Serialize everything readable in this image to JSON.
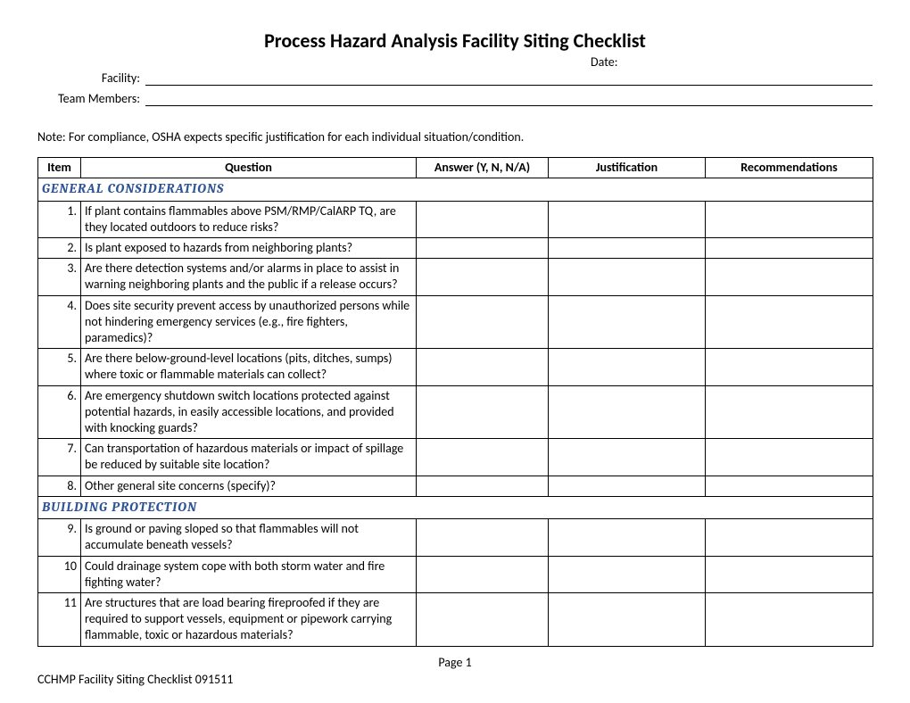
{
  "title": "Process Hazard Analysis Facility Siting Checklist",
  "header": {
    "facility_label": "Facility:",
    "team_label": "Team Members:",
    "date_label": "Date:"
  },
  "note": "Note:  For compliance, OSHA expects specific justification for each individual situation/condition.",
  "columns": {
    "item": "Item",
    "question": "Question",
    "answer": "Answer (Y, N, N/A)",
    "justification": "Justification",
    "recommendations": "Recommendations"
  },
  "sections": [
    {
      "title": "GENERAL CONSIDERATIONS",
      "rows": [
        {
          "num": "1.",
          "q": "If plant contains flammables above PSM/RMP/CalARP TQ, are they located outdoors to reduce risks?"
        },
        {
          "num": "2.",
          "q": "Is plant exposed to hazards from neighboring plants?"
        },
        {
          "num": "3.",
          "q": "Are there detection systems and/or alarms in place to assist in warning neighboring plants and the public if a release occurs?"
        },
        {
          "num": "4.",
          "q": "Does site security prevent access by unauthorized persons while not hindering emergency services (e.g., fire fighters, paramedics)?"
        },
        {
          "num": "5.",
          "q": "Are there below-ground-level locations (pits, ditches, sumps) where toxic or flammable materials can collect?"
        },
        {
          "num": "6.",
          "q": "Are emergency shutdown switch locations protected against potential hazards, in easily accessible locations, and provided with knocking guards?"
        },
        {
          "num": "7.",
          "q": "Can transportation of hazardous materials or impact of spillage be reduced by suitable site location?"
        },
        {
          "num": "8.",
          "q": "Other general site concerns (specify)?"
        }
      ]
    },
    {
      "title": "BUILDING PROTECTION",
      "rows": [
        {
          "num": "9.",
          "q": "Is ground or paving sloped so that flammables will not accumulate beneath vessels?"
        },
        {
          "num": "10",
          "q": "Could drainage system cope with both storm water and fire fighting water?"
        },
        {
          "num": "11",
          "q": "Are structures that are load bearing fireproofed if they are required to support vessels, equipment or pipework carrying flammable, toxic or hazardous materials?"
        }
      ]
    }
  ],
  "footer": {
    "page": "Page 1",
    "docid": "CCHMP Facility Siting Checklist 091511"
  }
}
